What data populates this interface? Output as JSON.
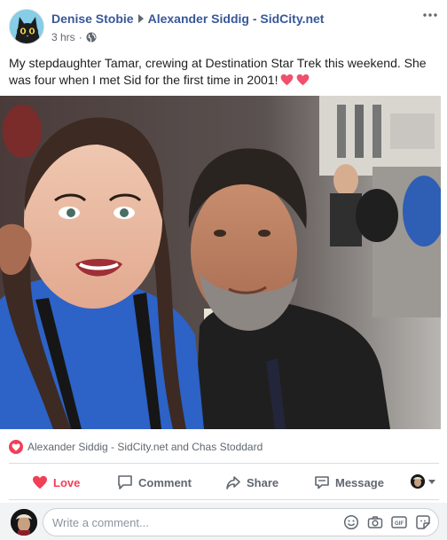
{
  "post": {
    "author": "Denise Stobie",
    "target_page": "Alexander Siddig - SidCity.net",
    "timestamp": "3 hrs",
    "privacy_icon": "globe-icon",
    "text": "My stepdaughter Tamar, crewing at Destination Star Trek this weekend. She was four when I met Sid for the first time in 2001!",
    "inline_emoji": "heart-icon"
  },
  "reactions": {
    "icon": "love-reaction-icon",
    "summary": "Alexander Siddig - SidCity.net and Chas Stoddard"
  },
  "actions": {
    "love_label": "Love",
    "comment_label": "Comment",
    "share_label": "Share",
    "message_label": "Message"
  },
  "comment": {
    "placeholder": "Write a comment...",
    "icons": [
      "emoji-icon",
      "camera-icon",
      "gif-icon",
      "sticker-icon"
    ]
  },
  "colors": {
    "link": "#385898",
    "love": "#f33e58",
    "muted": "#606770",
    "divider": "#dadde1",
    "comment_bg": "#f2f3f5"
  }
}
